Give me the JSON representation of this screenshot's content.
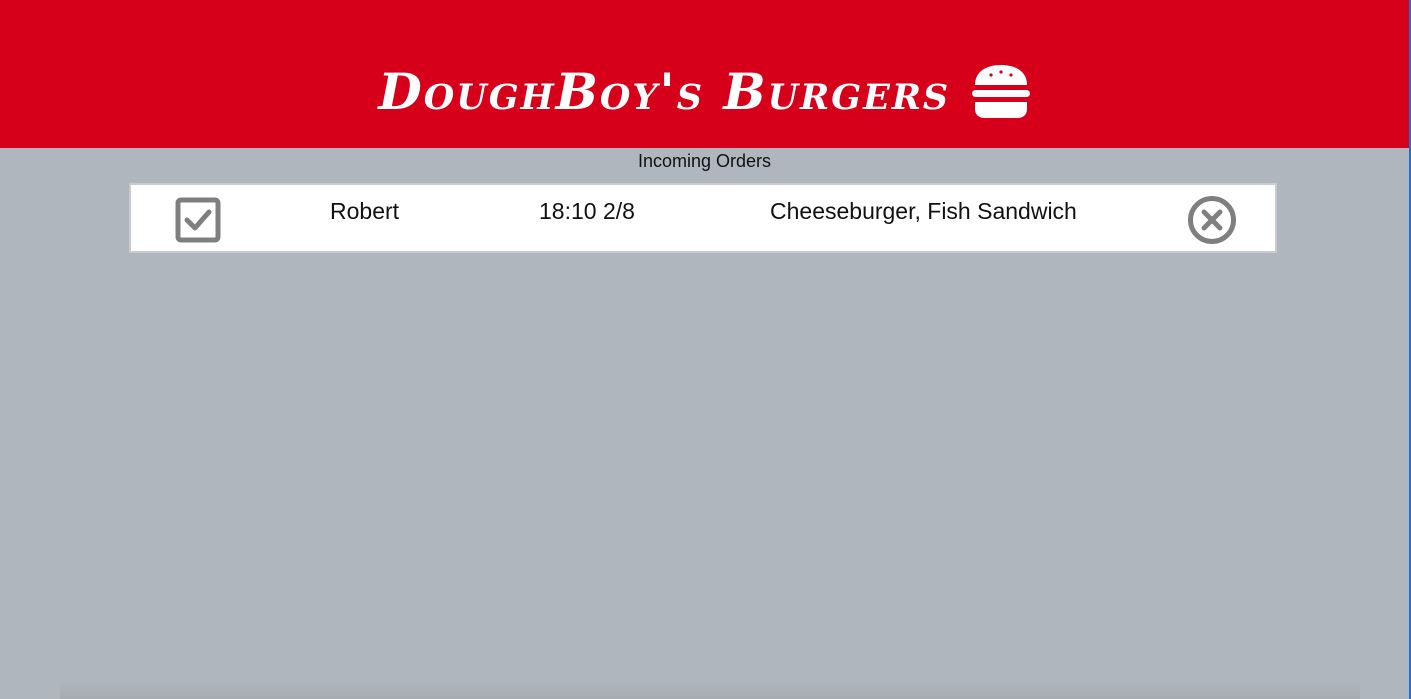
{
  "header": {
    "title": "DoughBoy's Burgers",
    "icon": "burger-icon",
    "background_color": "#d7001a"
  },
  "main": {
    "section_title": "Incoming Orders",
    "orders": [
      {
        "name": "Robert",
        "time": "18:10 2/8",
        "items": "Cheeseburger, Fish Sandwich",
        "complete_icon": "checkbox-checked-icon",
        "remove_icon": "circle-x-icon"
      }
    ]
  },
  "colors": {
    "accent": "#d7001a",
    "page_background": "#b0b6bd",
    "icon_gray": "#7f7f7f"
  }
}
